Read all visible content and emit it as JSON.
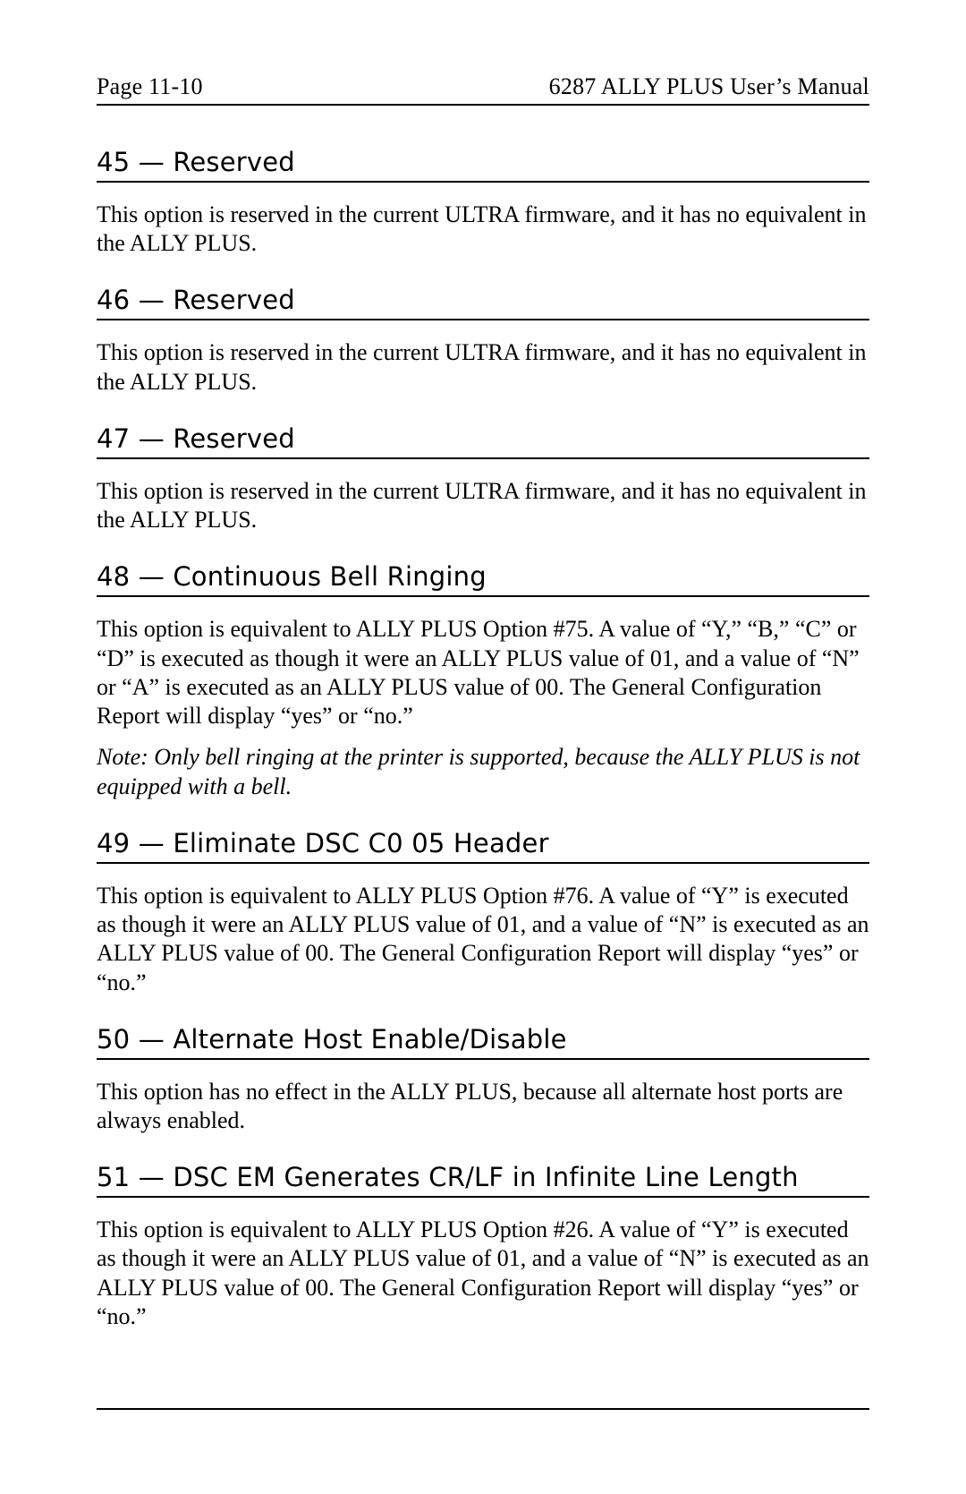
{
  "header": {
    "page_ref": "Page 11-10",
    "manual_title": "6287 ALLY PLUS User’s Manual"
  },
  "sections": [
    {
      "heading": "45 — Reserved",
      "paragraphs": [
        "This option is reserved in the current ULTRA firmware, and it has no equivalent in the ALLY PLUS."
      ]
    },
    {
      "heading": "46 — Reserved",
      "paragraphs": [
        "This option is reserved in the current ULTRA firmware, and it has no equivalent in the ALLY PLUS."
      ]
    },
    {
      "heading": "47 — Reserved",
      "paragraphs": [
        "This option is reserved in the current ULTRA firmware, and it has no equivalent in the ALLY PLUS."
      ]
    },
    {
      "heading": "48 — Continuous Bell Ringing",
      "paragraphs": [
        "This option is equivalent to ALLY PLUS Option #75. A value of “Y,” “B,” “C” or “D” is executed as though it were an ALLY PLUS value of 01, and a value of “N” or “A” is executed as an ALLY PLUS value of 00. The General Configuration Report will display “yes” or “no.”"
      ],
      "note": "Note: Only bell ringing at the printer is supported, because the ALLY PLUS is not equipped with a bell."
    },
    {
      "heading": "49 — Eliminate DSC C0 05 Header",
      "paragraphs": [
        "This option is equivalent to ALLY PLUS Option #76. A value of “Y” is executed as though it were an ALLY PLUS value of 01, and a value of “N” is executed as an ALLY PLUS value of 00. The General Configuration Report will display “yes” or “no.”"
      ]
    },
    {
      "heading": "50 — Alternate Host Enable/Disable",
      "paragraphs": [
        "This option has no effect in the ALLY PLUS, because all alternate host ports are always enabled."
      ]
    },
    {
      "heading": "51 — DSC EM Generates CR/LF in Infinite Line Length",
      "paragraphs": [
        "This option is equivalent to ALLY PLUS Option #26. A value of “Y” is executed as though it were an ALLY PLUS value of 01, and a value of “N” is executed as an ALLY PLUS value of 00. The General Configuration Report will display “yes” or “no.”"
      ]
    }
  ]
}
